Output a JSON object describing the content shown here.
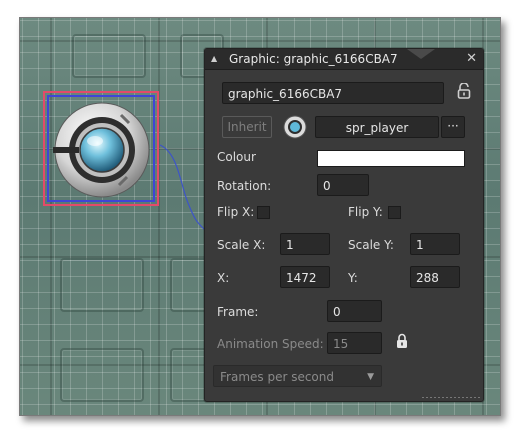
{
  "panel": {
    "title": "Graphic: graphic_6166CBA7",
    "collapse_icon": "triangle-collapse-icon",
    "close_icon": "close-icon",
    "name_value": "graphic_6166CBA7",
    "lock_icon": "unlocked-padlock-icon",
    "inherit_label": "Inherit",
    "sprite_value": "spr_player",
    "sprite_browse_label": "···",
    "colour_label": "Colour",
    "colour_value": "#ffffff",
    "rotation_label": "Rotation:",
    "rotation_value": "0",
    "flip_x_label": "Flip X:",
    "flip_y_label": "Flip Y:",
    "scale_x_label": "Scale X:",
    "scale_x_value": "1",
    "scale_y_label": "Scale Y:",
    "scale_y_value": "1",
    "x_label": "X:",
    "x_value": "1472",
    "y_label": "Y:",
    "y_value": "288",
    "frame_label": "Frame:",
    "frame_value": "0",
    "anim_speed_label": "Animation Speed:",
    "anim_speed_value": "15",
    "anim_lock_icon": "locked-padlock-icon",
    "speed_unit_selected": "Frames per second"
  },
  "colors": {
    "selection_outer": "#e34a6a",
    "selection_inner": "#3f45d6",
    "panel_bg": "#3a3a3a"
  }
}
